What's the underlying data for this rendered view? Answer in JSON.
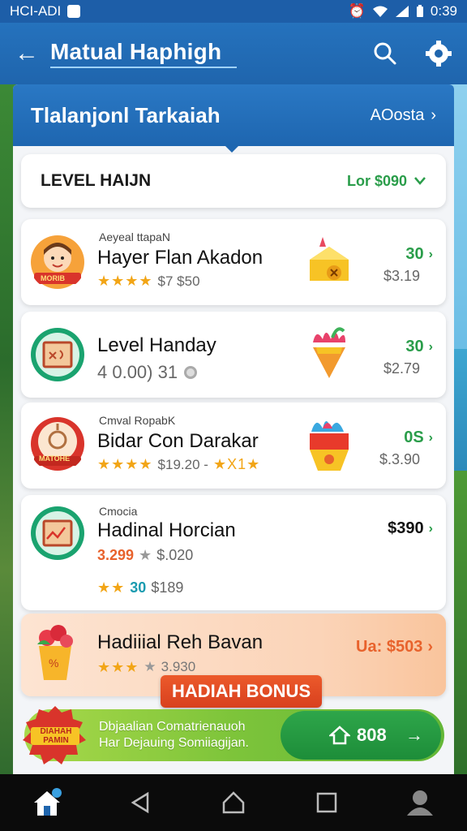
{
  "status_bar": {
    "carrier": "HCI-ADI",
    "time": "0:39"
  },
  "app_bar": {
    "title": "Matual Haphigh"
  },
  "panel": {
    "title": "Tlalanjonl Tarkaiah",
    "link_label": "AOosta"
  },
  "level": {
    "label": "LEVEL HAIJN",
    "value": "Lor $090"
  },
  "items": [
    {
      "subtitle": "Aeyeal ttapaN",
      "name": "Hayer Flan Akadon",
      "stars": "★★★★",
      "meta": "$7 $50",
      "points": "30",
      "price": "$3.19",
      "badge_text": "MORIB"
    },
    {
      "subtitle": "",
      "name": "Level Handay",
      "meta": "4 0.00) 31",
      "points": "30",
      "price": "$2.79"
    },
    {
      "subtitle": "Cmval RopabK",
      "name": "Bidar Con Darakar",
      "stars": "★★★★",
      "meta": "$19.20 -",
      "meta_stars": "★X1★",
      "points": "0S",
      "price": "$.3.90",
      "badge_text": "MATOHE"
    },
    {
      "subtitle": "Cmocia",
      "name": "Hadinal Horcian",
      "meta_orange": "3.299",
      "meta": "$.020",
      "stars2": "★★",
      "points2": "30",
      "price2": "$189",
      "points": "$390"
    }
  ],
  "bonus": {
    "name": "Hadiiial Reh Bavan",
    "stars": "★★★",
    "meta": "3.930",
    "value": "Ua: $503",
    "tag": "HADIAH BONUS"
  },
  "promo": {
    "line1": "Dbjaalian Comatrienauoh",
    "line2": "Har Dejauing Somiiagijan.",
    "cta": "808",
    "badge_text": "DIAHAH PAMIN"
  },
  "colors": {
    "primary": "#1f65ad",
    "green": "#2a9d4a",
    "orange": "#e8622c"
  }
}
